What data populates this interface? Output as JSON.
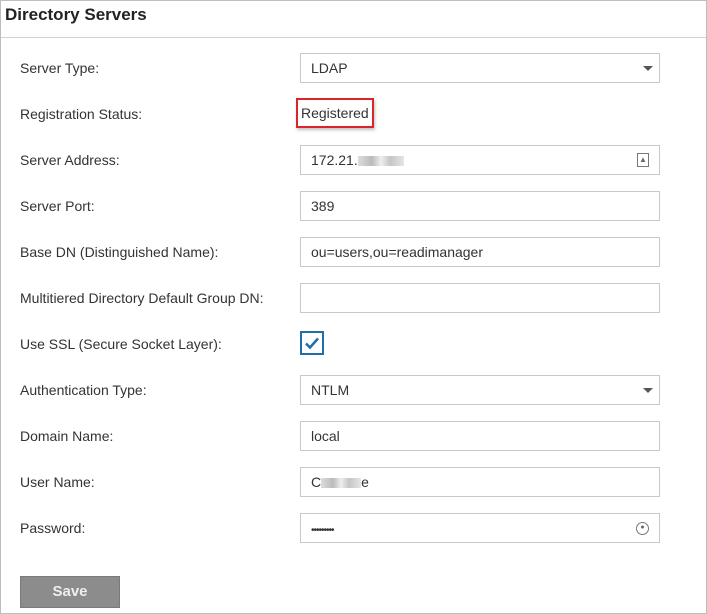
{
  "title": "Directory Servers",
  "fields": [
    {
      "label": "Server Type:",
      "value": "LDAP"
    },
    {
      "label": "Registration Status:",
      "value": "Registered"
    },
    {
      "label": "Server Address:",
      "value": "172.21."
    },
    {
      "label": "Server Port:",
      "value": "389"
    },
    {
      "label": "Base DN (Distinguished Name):",
      "value": "ou=users,ou=readimanager"
    },
    {
      "label": "Multitiered Directory Default Group DN:",
      "value": ""
    },
    {
      "label": "Use SSL (Secure Socket Layer):",
      "checked": true
    },
    {
      "label": "Authentication Type:",
      "value": "NTLM"
    },
    {
      "label": "Domain Name:",
      "value": "local"
    },
    {
      "label": "User Name:",
      "value": "C",
      "value_end": "e"
    },
    {
      "label": "Password:",
      "value": "•••••••••"
    }
  ],
  "save_label": "Save",
  "colors": {
    "accent": "#1e6ea8",
    "highlight": "#d9262b",
    "button": "#8c8c8c"
  }
}
